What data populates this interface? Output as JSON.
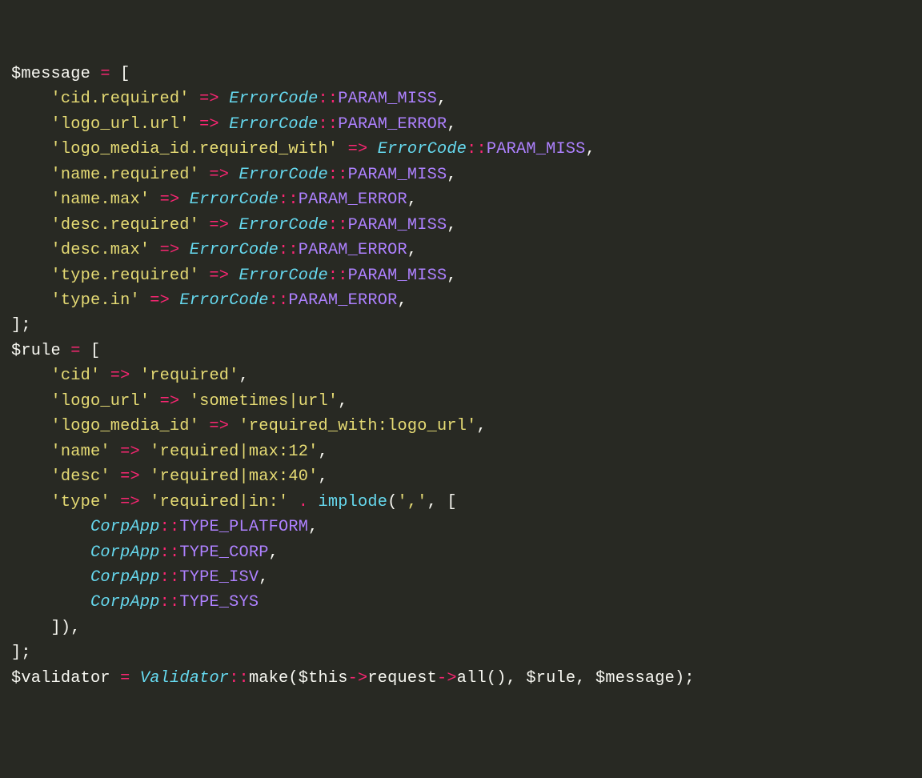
{
  "code": {
    "message_assign": {
      "var": "$message",
      "entries": [
        {
          "key": "'cid.required'",
          "class": "ErrorCode",
          "const": "PARAM_MISS"
        },
        {
          "key": "'logo_url.url'",
          "class": "ErrorCode",
          "const": "PARAM_ERROR"
        },
        {
          "key": "'logo_media_id.required_with'",
          "class": "ErrorCode",
          "const": "PARAM_MISS"
        },
        {
          "key": "'name.required'",
          "class": "ErrorCode",
          "const": "PARAM_MISS"
        },
        {
          "key": "'name.max'",
          "class": "ErrorCode",
          "const": "PARAM_ERROR"
        },
        {
          "key": "'desc.required'",
          "class": "ErrorCode",
          "const": "PARAM_MISS"
        },
        {
          "key": "'desc.max'",
          "class": "ErrorCode",
          "const": "PARAM_ERROR"
        },
        {
          "key": "'type.required'",
          "class": "ErrorCode",
          "const": "PARAM_MISS"
        },
        {
          "key": "'type.in'",
          "class": "ErrorCode",
          "const": "PARAM_ERROR"
        }
      ]
    },
    "rule_assign": {
      "var": "$rule",
      "entries": [
        {
          "key": "'cid'",
          "val": "'required'"
        },
        {
          "key": "'logo_url'",
          "val": "'sometimes|url'"
        },
        {
          "key": "'logo_media_id'",
          "val": "'required_with:logo_url'"
        },
        {
          "key": "'name'",
          "val": "'required|max:12'"
        },
        {
          "key": "'desc'",
          "val": "'required|max:40'"
        }
      ],
      "type_key": "'type'",
      "type_prefix": "'required|in:'",
      "implode_func": "implode",
      "implode_sep": "','",
      "corp_consts": [
        {
          "class": "CorpApp",
          "const": "TYPE_PLATFORM"
        },
        {
          "class": "CorpApp",
          "const": "TYPE_CORP"
        },
        {
          "class": "CorpApp",
          "const": "TYPE_ISV"
        },
        {
          "class": "CorpApp",
          "const": "TYPE_SYS"
        }
      ]
    },
    "validator_line": {
      "var": "$validator",
      "class": "Validator",
      "make": "make",
      "this": "$this",
      "request": "request",
      "all": "all",
      "rule": "$rule",
      "message": "$message"
    }
  }
}
